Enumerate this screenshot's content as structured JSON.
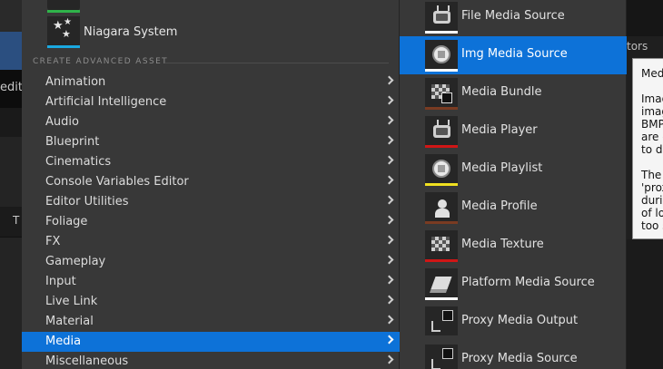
{
  "background": {
    "left_text": "edit",
    "left_tab": "T",
    "right_tab": "tors"
  },
  "left_menu": {
    "pinned_item": "Niagara System",
    "section_header": "CREATE ADVANCED ASSET",
    "categories": [
      {
        "label": "Animation"
      },
      {
        "label": "Artificial Intelligence"
      },
      {
        "label": "Audio"
      },
      {
        "label": "Blueprint"
      },
      {
        "label": "Cinematics"
      },
      {
        "label": "Console Variables Editor"
      },
      {
        "label": "Editor Utilities"
      },
      {
        "label": "Foliage"
      },
      {
        "label": "FX"
      },
      {
        "label": "Gameplay"
      },
      {
        "label": "Input"
      },
      {
        "label": "Live Link"
      },
      {
        "label": "Material"
      },
      {
        "label": "Media"
      },
      {
        "label": "Miscellaneous"
      }
    ],
    "active_category": "Media"
  },
  "submenu": {
    "items": [
      {
        "label": "File Media Source",
        "icon": "tv-icon",
        "color": "#ffffff"
      },
      {
        "label": "Img Media Source",
        "icon": "sphere-cube-icon",
        "color": "#ffffff"
      },
      {
        "label": "Media Bundle",
        "icon": "checker-icon",
        "color": "#7a3b22"
      },
      {
        "label": "Media Player",
        "icon": "tv-icon",
        "color": "#d01616"
      },
      {
        "label": "Media Playlist",
        "icon": "sphere-cube-icon",
        "color": "#f0e020"
      },
      {
        "label": "Media Profile",
        "icon": "person-icon",
        "color": "#7a3b22"
      },
      {
        "label": "Media Texture",
        "icon": "tv-checker-icon",
        "color": "#d01616"
      },
      {
        "label": "Platform Media Source",
        "icon": "stack-icon",
        "color": "#ffffff"
      },
      {
        "label": "Proxy Media Output",
        "icon": "proxy-output-icon",
        "color": "#383838"
      },
      {
        "label": "Proxy Media Source",
        "icon": "proxy-source-icon",
        "color": "#383838"
      }
    ],
    "active_item": "Img Media Source"
  },
  "tooltip": {
    "title": "Med",
    "lines": [
      "Imag",
      "imag",
      "BMP",
      "are c",
      "to de",
      "",
      "The",
      "'prox",
      "durin",
      "of lo",
      "too s"
    ]
  }
}
